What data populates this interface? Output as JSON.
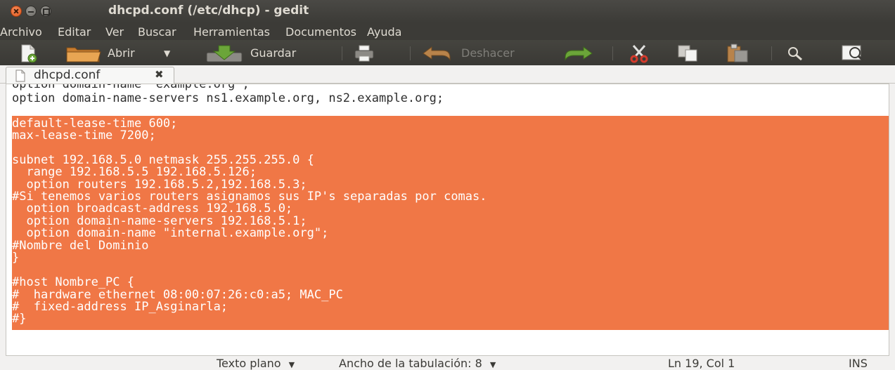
{
  "window": {
    "title": "dhcpd.conf (/etc/dhcp) - gedit"
  },
  "menu": {
    "items": [
      "Archivo",
      "Editar",
      "Ver",
      "Buscar",
      "Herramientas",
      "Documentos",
      "Ayuda"
    ]
  },
  "toolbar": {
    "open_label": "Abrir",
    "save_label": "Guardar",
    "undo_label": "Deshacer",
    "dropdown_arrow": "▼"
  },
  "tab": {
    "label": "dhcpd.conf",
    "close_glyph": "✖"
  },
  "editor": {
    "lines": [
      "option domain-name \"example.org\";",
      "option domain-name-servers ns1.example.org, ns2.example.org;",
      "",
      "default-lease-time 600;",
      "max-lease-time 7200;",
      "",
      "subnet 192.168.5.0 netmask 255.255.255.0 {",
      "  range 192.168.5.5 192.168.5.126;",
      "  option routers 192.168.5.2,192.168.5.3;",
      "#Si tenemos varios routers asignamos sus IP's separadas por comas.",
      "  option broadcast-address 192.168.5.0;",
      "  option domain-name-servers 192.168.5.1;",
      "  option domain-name \"internal.example.org\";",
      "#Nombre del Dominio",
      "}",
      "",
      "#host Nombre_PC {",
      "#  hardware ethernet 08:00:07:26:c0:a5; MAC_PC",
      "#  fixed-address IP_Asginarla;",
      "#}"
    ]
  },
  "status": {
    "language": "Texto plano",
    "tab_width": "Ancho de la tabulación:  8",
    "dropdown_arrow": "▼",
    "position": "Ln 19, Col 1",
    "mode": "INS"
  },
  "colors": {
    "selection": "#f07746",
    "titlebar": "#3c3b37",
    "text": "#2e2e2e"
  }
}
